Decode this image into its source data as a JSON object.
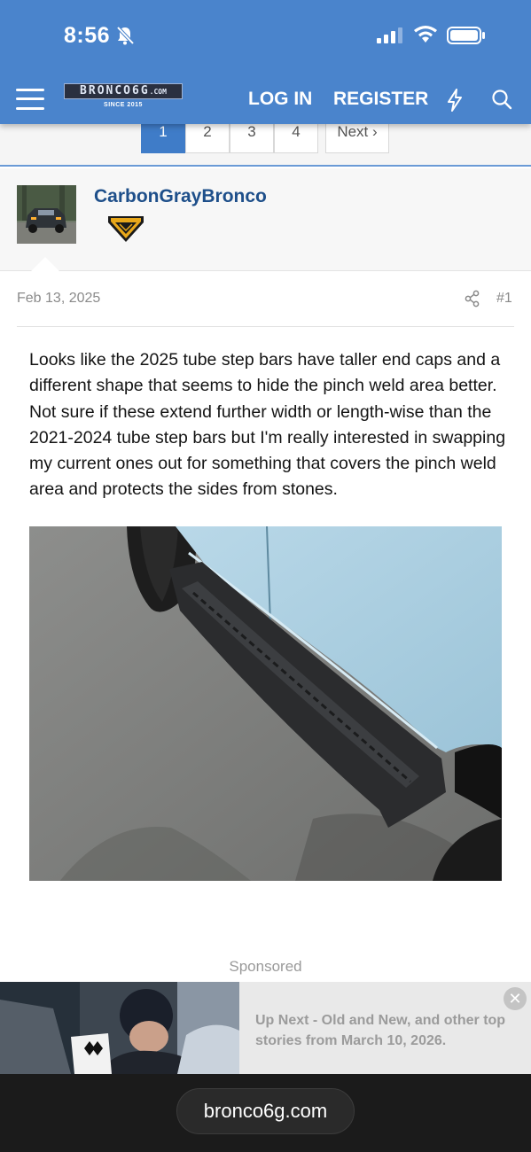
{
  "status_bar": {
    "time": "8:56",
    "icons": [
      "bell-slash-icon",
      "signal-icon",
      "wifi-icon",
      "battery-icon"
    ]
  },
  "nav": {
    "logo_text": "BRONCO6G",
    "logo_domain": ".COM",
    "logo_sub": "SINCE 2015",
    "login_label": "LOG IN",
    "register_label": "REGISTER",
    "icons": [
      "menu-icon",
      "bolt-icon",
      "search-icon"
    ]
  },
  "pagination": {
    "pages": [
      "1",
      "2",
      "3",
      "4"
    ],
    "current": "1",
    "next_label": "Next ›"
  },
  "post": {
    "author": "CarbonGrayBronco",
    "badge_text": "BADLANDS",
    "date": "Feb 13, 2025",
    "number": "#1",
    "body": "Looks like the 2025 tube step bars have taller end caps and a different shape that seems to hide the pinch weld area better. Not sure if these extend further width or length-wise than the 2021-2024 tube step bars but I'm really interested in swapping my current ones out for something that covers the pinch weld area and protects the sides from stones."
  },
  "ad": {
    "sponsored_label": "Sponsored",
    "headline": "Up Next - Old and New, and other top stories from March 10, 2026.",
    "close_glyph": "✕"
  },
  "browser": {
    "url": "bronco6g.com"
  },
  "colors": {
    "header": "#4a84cc",
    "accent": "#3f7cc8",
    "username": "#1e4f8a"
  }
}
